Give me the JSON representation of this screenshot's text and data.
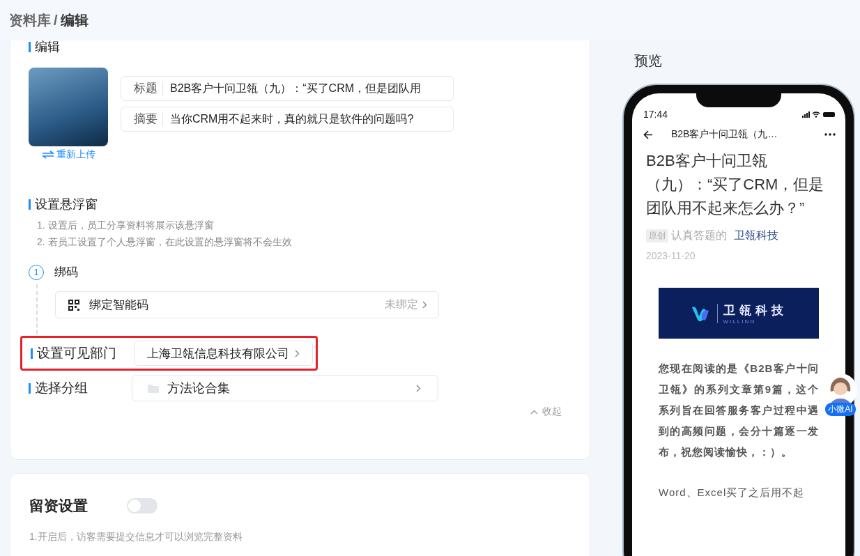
{
  "breadcrumb": {
    "parent": "资料库",
    "separator": "/",
    "current": "编辑"
  },
  "edit_section": {
    "heading": "编辑",
    "reupload_link": "重新上传",
    "fields": [
      {
        "label": "标题",
        "value": "B2B客户十问卫瓴（九）：“买了CRM，但是团队用"
      },
      {
        "label": "摘要",
        "value": "当你CRM用不起来时，真的就只是软件的问题吗?"
      }
    ]
  },
  "float_window": {
    "heading": "设置悬浮窗",
    "notes": [
      "1. 设置后，员工分享资料将展示该悬浮窗",
      "2. 若员工设置了个人悬浮窗，在此设置的悬浮窗将不会生效"
    ],
    "steps": [
      {
        "number": "1",
        "label": "绑码",
        "option": {
          "label": "绑定智能码",
          "status": "未绑定"
        }
      }
    ]
  },
  "visible_department": {
    "label": "设置可见部门",
    "value": "上海卫瓴信息科技有限公司",
    "highlighted": true
  },
  "group": {
    "label": "选择分组",
    "value": "方法论合集"
  },
  "collapse": "收起",
  "lead_settings": {
    "heading": "留资设置",
    "on": false,
    "note": "1.开启后，访客需要提交信息才可以浏览完整资料"
  },
  "preview": {
    "heading": "预览",
    "time": "17:44",
    "nav_title": "B2B客户十问卫瓴（九…",
    "article_title": "B2B客户十问卫瓴（九）：“买了CRM，但是团队用不起来怎么办？”",
    "tag": "原创",
    "author": "认真答题的",
    "account": "卫瓴科技",
    "date": "2023-11-20",
    "banner": {
      "name": "卫瓴科技",
      "subtitle": "WILLING"
    },
    "paragraphs": [
      "您现在阅读的是《B2B客户十问卫瓴》的系列文章第9篇，这个系列旨在回答服务客户过程中遇到的高频问题，会分十篇逐一发布，祝您阅读愉快，：）。",
      "Word、Excel买了之后用不起"
    ]
  },
  "assistant": {
    "label": "小微AI"
  }
}
